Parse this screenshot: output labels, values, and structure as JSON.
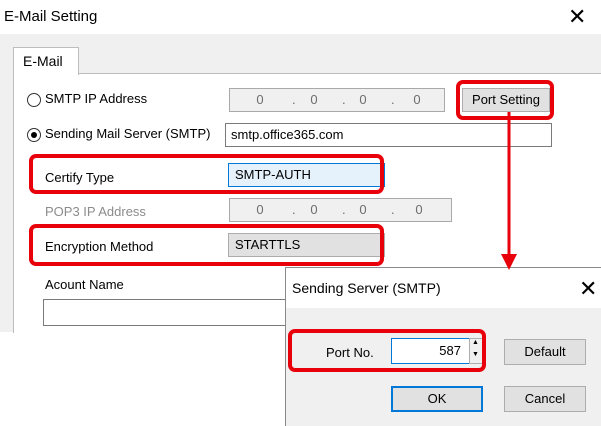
{
  "main_dialog": {
    "title": "E-Mail Setting",
    "close_glyph": "✕",
    "tab_label": "E-Mail",
    "smtp_ip_label": "SMTP IP Address",
    "smtp_ip": [
      "0",
      "0",
      "0",
      "0"
    ],
    "ip_separator": ".",
    "port_setting_label": "Port Setting",
    "sending_server_label": "Sending Mail Server (SMTP)",
    "sending_server_value": "smtp.office365.com",
    "certify_type_label": "Certify Type",
    "certify_type_value": "SMTP-AUTH",
    "pop3_label": "POP3 IP Address",
    "pop3_ip": [
      "0",
      "0",
      "0",
      "0"
    ],
    "encryption_label": "Encryption Method",
    "encryption_value": "STARTTLS",
    "account_name_label": "Acount Name",
    "selected_option": "sending-mail-server"
  },
  "sub_dialog": {
    "title": "Sending Server (SMTP)",
    "close_glyph": "✕",
    "port_label": "Port No.",
    "port_value": "587",
    "default_label": "Default",
    "ok_label": "OK",
    "cancel_label": "Cancel"
  },
  "glyphs": {
    "dropdown": "⌵",
    "spin_up": "▲",
    "spin_down": "▼"
  },
  "colors": {
    "highlight": "#e8000b",
    "focus_blue": "#0078d7",
    "dialog_bg": "#f0f0f0"
  }
}
